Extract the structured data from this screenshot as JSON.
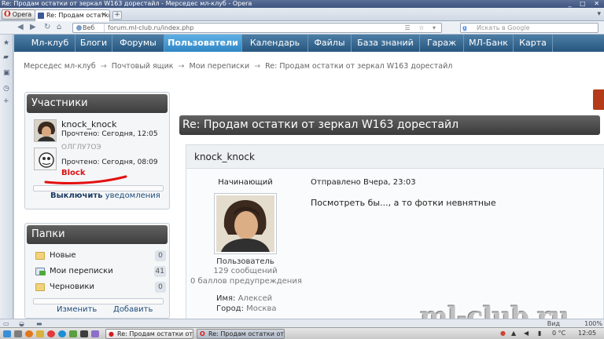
{
  "window": {
    "title": "Re: Продам остатки от зеркал W163 дорестайл - Мерседес мл-клуб - Opera"
  },
  "browser": {
    "opera_label": "Opera",
    "tab_title": "Re: Продам остатки ...",
    "url_prefix": "Веб",
    "url": "forum.ml-club.ru/index.php",
    "search_placeholder": "Искать в Google"
  },
  "nav": {
    "items": [
      "Мл-клуб",
      "Блоги",
      "Форумы",
      "Пользователи",
      "Календарь",
      "Файлы",
      "База знаний",
      "Гараж",
      "МЛ-Банк",
      "Карта"
    ],
    "active": "Пользователи"
  },
  "breadcrumb": [
    "Мерседес мл-клуб",
    "Почтовый ящик",
    "Мои переписки",
    "Re: Продам остатки от зеркал W163 дорестайл"
  ],
  "participants": {
    "title": "Участники",
    "items": [
      {
        "name": "knock_knock",
        "read": "Прочтено: Сегодня, 12:05"
      },
      {
        "name": "ОЛГЛУ7ОЭ",
        "read": "Прочтено: Сегодня, 08:09",
        "badge": "Block"
      }
    ],
    "disable_bold": "Выключить",
    "disable_rest": "уведомления"
  },
  "folders": {
    "title": "Папки",
    "items": [
      {
        "label": "Новые",
        "count": "0"
      },
      {
        "label": "Мои переписки",
        "count": "41"
      },
      {
        "label": "Черновики",
        "count": "0"
      }
    ],
    "edit_label": "Изменить",
    "add_label": "Добавить"
  },
  "thread": {
    "title": "Re: Продам остатки от зеркал W163 дорестайл"
  },
  "post": {
    "author": "knock_knock",
    "role": "Начинающий",
    "user_type": "Пользователь",
    "messages": "129 сообщений",
    "warnings": "0 баллов предупреждения",
    "name_label": "Имя:",
    "name_value": "Алексей",
    "city_label": "Город:",
    "city_value": "Москва",
    "sent": "Отправлено Вчера, 23:03",
    "text": "Посмотреть бы..., а то фотки невнятные"
  },
  "watermark": "ml-club.ru",
  "statusbar": {
    "view_label": "Вид",
    "zoom": "100%"
  },
  "taskbar": {
    "tasks": [
      "Re: Продам остатки от з...",
      "Re: Продам остатки от з..."
    ],
    "temperature": "0 °C",
    "clock": "12:05"
  },
  "colors": {
    "nav": "#27577f",
    "nav_active": "#2f86c4",
    "box_header": "#4a4a4a",
    "block": "#dd1111"
  }
}
